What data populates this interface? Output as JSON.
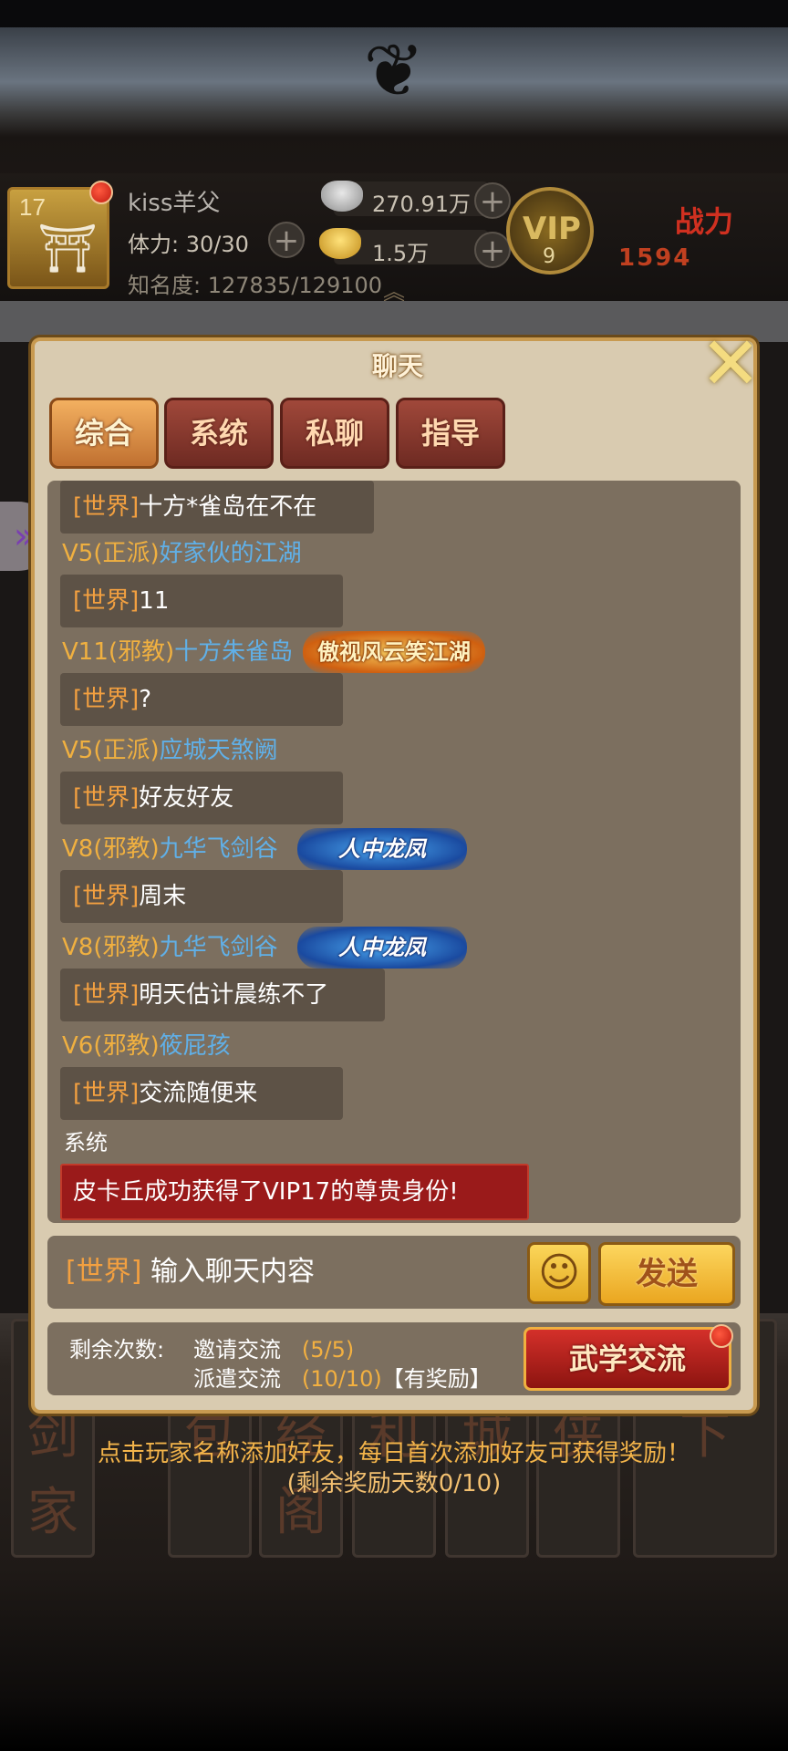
{
  "header": {
    "level": "17",
    "player_name": "kiss羊父",
    "stamina": "体力: 30/30",
    "fame": "知名度: 127835/129100",
    "silver": "270.91万",
    "gold": "1.5万",
    "vip_label": "VIP",
    "vip_level": "9",
    "power_label": "战力",
    "power_value": "1594",
    "plus": "+"
  },
  "chat": {
    "title": "聊天",
    "close": "✕",
    "tabs": [
      "综合",
      "系统",
      "私聊",
      "指导"
    ],
    "messages": [
      {
        "channel": "[世界]",
        "text": "十方*雀岛在不在"
      },
      {
        "vip": "V5(正派)",
        "name": "好家伙的江湖"
      },
      {
        "channel": "[世界]",
        "text": "11"
      },
      {
        "vip": "V11(邪教)",
        "name": "十方朱雀岛",
        "badge": "傲视风云笑江湖"
      },
      {
        "channel": "[世界]",
        "text": "?"
      },
      {
        "vip": "V5(正派)",
        "name": "应城天煞阙"
      },
      {
        "channel": "[世界]",
        "text": "好友好友"
      },
      {
        "vip": "V8(邪教)",
        "name": "九华飞剑谷",
        "badge": "人中龙凤"
      },
      {
        "channel": "[世界]",
        "text": "周末"
      },
      {
        "vip": "V8(邪教)",
        "name": "九华飞剑谷",
        "badge": "人中龙凤"
      },
      {
        "channel": "[世界]",
        "text": "明天估计晨练不了"
      },
      {
        "vip": "V6(邪教)",
        "name": "筱屁孩"
      },
      {
        "channel": "[世界]",
        "text": "交流随便来"
      }
    ],
    "system_label": "系统",
    "system_message": "皮卡丘成功获得了VIP17的尊贵身份!",
    "input_channel": "[世界]",
    "input_placeholder": "输入聊天内容",
    "send": "发送",
    "remaining_label": "剩余次数:",
    "invite_label": "邀请交流",
    "invite_count": "(5/5)",
    "dispatch_label": "派遣交流",
    "dispatch_count": "(10/10)",
    "reward_note": "【有奖励】",
    "martial_btn": "武学交流"
  },
  "tip": {
    "line1": "点击玩家名称添加好友，每日首次添加好友可获得奖励！",
    "line2": "(剩余奖励天数0/10)"
  },
  "menu_tiles": [
    "天剑家",
    "背包",
    "藏经阁",
    "福利",
    "商城",
    "寻侠",
    "剑天下"
  ],
  "icons": {
    "pagoda": "pagoda-icon",
    "silver": "silver-ingot-icon",
    "gold": "gold-ingot-icon",
    "emoji": "smiley-icon",
    "arrows": "double-chevron-icon"
  },
  "colors": {
    "channel": "#f3a040",
    "vip": "#f0b040",
    "name": "#60b0e8",
    "system_bubble": "#9a1a1a",
    "tip": "#f3b44a"
  }
}
